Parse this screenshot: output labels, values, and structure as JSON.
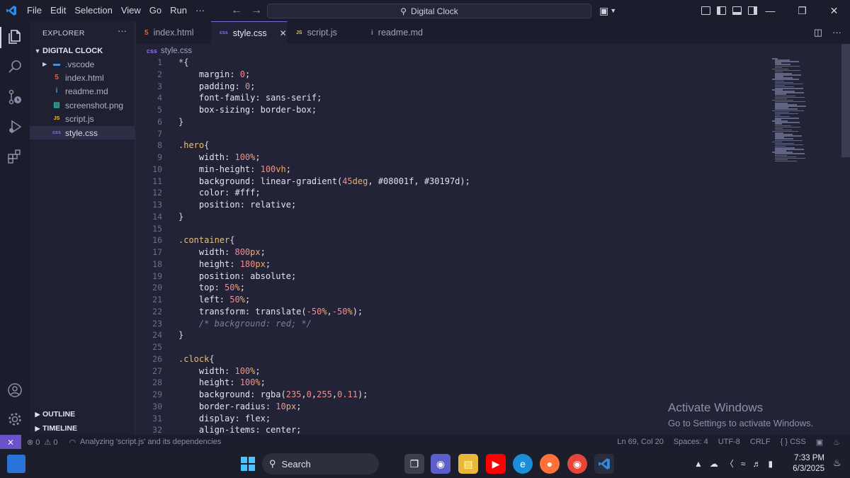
{
  "menu": [
    "File",
    "Edit",
    "Selection",
    "View",
    "Go",
    "Run",
    "···"
  ],
  "command_center": "Digital Clock",
  "window_controls": {
    "minimize": "—",
    "restore": "❐",
    "close": "✕"
  },
  "sidebar": {
    "title": "EXPLORER",
    "more": "···",
    "folder": "DIGITAL CLOCK",
    "items": [
      {
        "label": ".vscode",
        "icon": "folder-icon",
        "icon_color": "#4a90d9",
        "glyph": "▬"
      },
      {
        "label": "index.html",
        "icon": "html-icon",
        "icon_color": "#e8613a",
        "glyph": "5"
      },
      {
        "label": "readme.md",
        "icon": "info-icon",
        "icon_color": "#4a9ee8",
        "glyph": "i"
      },
      {
        "label": "screenshot.png",
        "icon": "image-icon",
        "icon_color": "#2bb3a8",
        "glyph": "▧"
      },
      {
        "label": "script.js",
        "icon": "js-icon",
        "icon_color": "#e8c53a",
        "glyph": "JS"
      },
      {
        "label": "style.css",
        "icon": "css-icon",
        "icon_color": "#8c6ee6",
        "glyph": "css"
      }
    ],
    "outline": "OUTLINE",
    "timeline": "TIMELINE"
  },
  "tabs": [
    {
      "label": "index.html",
      "icon_color": "#e8613a",
      "glyph": "5",
      "active": false
    },
    {
      "label": "style.css",
      "icon_color": "#8c6ee6",
      "glyph": "css",
      "active": true
    },
    {
      "label": "script.js",
      "icon_color": "#e8c53a",
      "glyph": "JS",
      "active": false
    },
    {
      "label": "readme.md",
      "icon_color": "#4a9ee8",
      "glyph": "i",
      "active": false
    }
  ],
  "tab_close": "✕",
  "breadcrumb": "style.css",
  "editor_lines": [
    [
      [
        "sel",
        "*"
      ],
      [
        "brace",
        "{"
      ]
    ],
    [
      [
        "prop",
        "    margin"
      ],
      [
        "val",
        ": "
      ],
      [
        "num",
        "0"
      ],
      [
        "val",
        ";"
      ]
    ],
    [
      [
        "prop",
        "    padding"
      ],
      [
        "val",
        ": "
      ],
      [
        "num",
        "0"
      ],
      [
        "val",
        ";"
      ]
    ],
    [
      [
        "prop",
        "    font-family"
      ],
      [
        "val",
        ": sans-serif;"
      ]
    ],
    [
      [
        "prop",
        "    box-sizing"
      ],
      [
        "val",
        ": border-box;"
      ]
    ],
    [
      [
        "brace",
        "}"
      ]
    ],
    [],
    [
      [
        "sel",
        ".hero"
      ],
      [
        "brace",
        "{"
      ]
    ],
    [
      [
        "prop",
        "    width"
      ],
      [
        "val",
        ": "
      ],
      [
        "num",
        "100"
      ],
      [
        "unit",
        "%"
      ],
      [
        "val",
        ";"
      ]
    ],
    [
      [
        "prop",
        "    min-height"
      ],
      [
        "val",
        ": "
      ],
      [
        "num",
        "100"
      ],
      [
        "unit",
        "vh"
      ],
      [
        "val",
        ";"
      ]
    ],
    [
      [
        "prop",
        "    background"
      ],
      [
        "val",
        ": linear-gradient("
      ],
      [
        "num",
        "45"
      ],
      [
        "unit",
        "deg"
      ],
      [
        "val",
        ", #08001f, #30197d);"
      ]
    ],
    [
      [
        "prop",
        "    color"
      ],
      [
        "val",
        ": #fff;"
      ]
    ],
    [
      [
        "prop",
        "    position"
      ],
      [
        "val",
        ": relative;"
      ]
    ],
    [
      [
        "brace",
        "}"
      ]
    ],
    [],
    [
      [
        "sel",
        ".container"
      ],
      [
        "brace",
        "{"
      ]
    ],
    [
      [
        "prop",
        "    width"
      ],
      [
        "val",
        ": "
      ],
      [
        "num",
        "800"
      ],
      [
        "unit",
        "px"
      ],
      [
        "val",
        ";"
      ]
    ],
    [
      [
        "prop",
        "    height"
      ],
      [
        "val",
        ": "
      ],
      [
        "num",
        "180"
      ],
      [
        "unit",
        "px"
      ],
      [
        "val",
        ";"
      ]
    ],
    [
      [
        "prop",
        "    position"
      ],
      [
        "val",
        ": absolute;"
      ]
    ],
    [
      [
        "prop",
        "    top"
      ],
      [
        "val",
        ": "
      ],
      [
        "num",
        "50"
      ],
      [
        "unit",
        "%"
      ],
      [
        "val",
        ";"
      ]
    ],
    [
      [
        "prop",
        "    left"
      ],
      [
        "val",
        ": "
      ],
      [
        "num",
        "50"
      ],
      [
        "unit",
        "%"
      ],
      [
        "val",
        ";"
      ]
    ],
    [
      [
        "prop",
        "    transform"
      ],
      [
        "val",
        ": translate("
      ],
      [
        "num",
        "-50"
      ],
      [
        "unit",
        "%"
      ],
      [
        "val",
        ","
      ],
      [
        "num",
        "-50"
      ],
      [
        "unit",
        "%"
      ],
      [
        "val",
        ");"
      ]
    ],
    [
      [
        "cmt",
        "    /* background: red; */"
      ]
    ],
    [
      [
        "brace",
        "}"
      ]
    ],
    [],
    [
      [
        "sel",
        ".clock"
      ],
      [
        "brace",
        "{"
      ]
    ],
    [
      [
        "prop",
        "    width"
      ],
      [
        "val",
        ": "
      ],
      [
        "num",
        "100"
      ],
      [
        "unit",
        "%"
      ],
      [
        "val",
        ";"
      ]
    ],
    [
      [
        "prop",
        "    height"
      ],
      [
        "val",
        ": "
      ],
      [
        "num",
        "100"
      ],
      [
        "unit",
        "%"
      ],
      [
        "val",
        ";"
      ]
    ],
    [
      [
        "prop",
        "    background"
      ],
      [
        "val",
        ": rgba("
      ],
      [
        "num",
        "235"
      ],
      [
        "val",
        ","
      ],
      [
        "num",
        "0"
      ],
      [
        "val",
        ","
      ],
      [
        "num",
        "255"
      ],
      [
        "val",
        ","
      ],
      [
        "num",
        "0.11"
      ],
      [
        "val",
        ");"
      ]
    ],
    [
      [
        "prop",
        "    border-radius"
      ],
      [
        "val",
        ": "
      ],
      [
        "num",
        "10"
      ],
      [
        "unit",
        "px"
      ],
      [
        "val",
        ";"
      ]
    ],
    [
      [
        "prop",
        "    display"
      ],
      [
        "val",
        ": flex;"
      ]
    ],
    [
      [
        "prop",
        "    align-items"
      ],
      [
        "val",
        ": center;"
      ]
    ]
  ],
  "watermark": {
    "line1": "Activate Windows",
    "line2": "Go to Settings to activate Windows."
  },
  "status": {
    "remote": "⨯",
    "errors": "⊗ 0",
    "warnings": "⚠ 0",
    "task": "Analyzing 'script.js' and its dependencies",
    "position": "Ln 69, Col 20",
    "spaces": "Spaces: 4",
    "encoding": "UTF-8",
    "eol": "CRLF",
    "language": "{ } CSS"
  },
  "taskbar": {
    "search": "Search",
    "time": "7:33 PM",
    "date": "6/3/2025"
  }
}
